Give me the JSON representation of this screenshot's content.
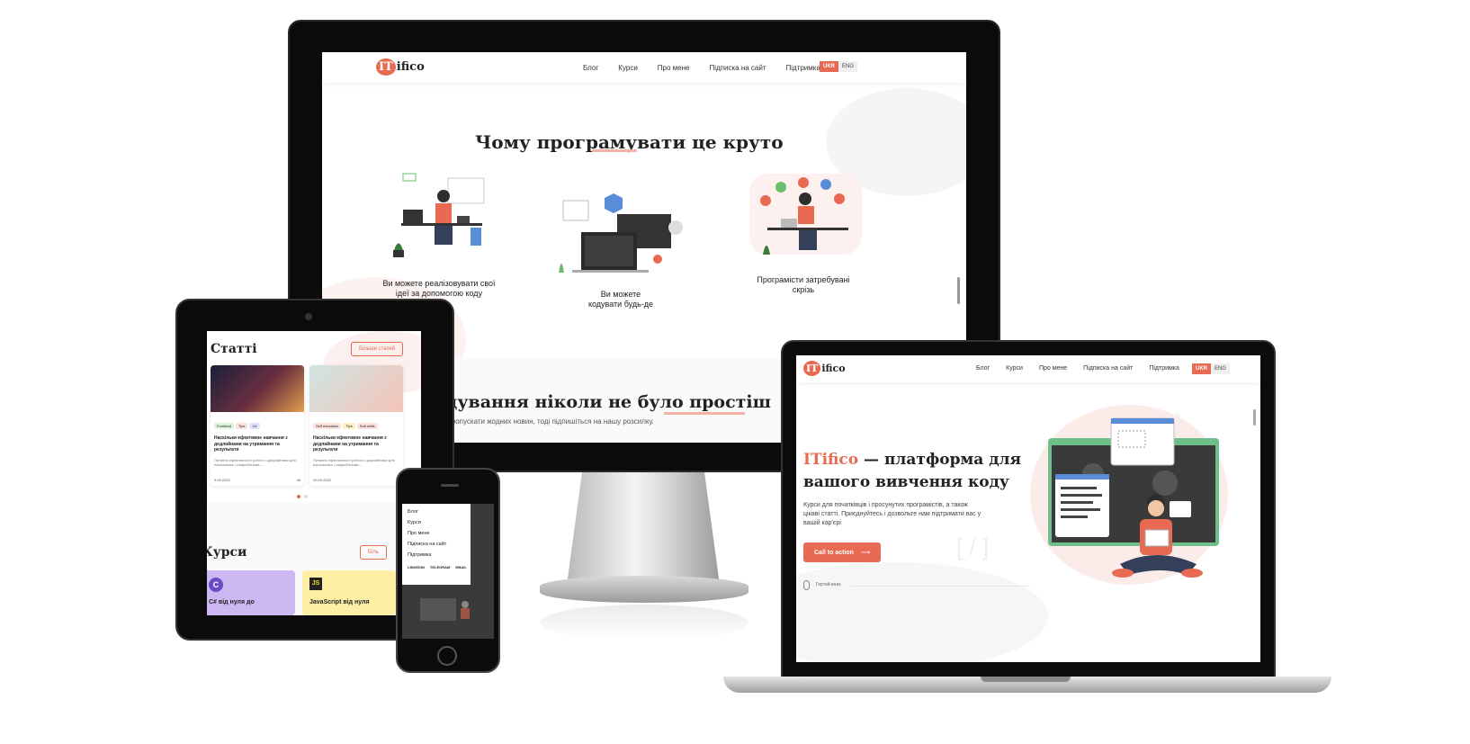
{
  "brand": {
    "logo_it": "IT",
    "logo_rest": "ifico",
    "accent": "#e86a52"
  },
  "nav": {
    "items": [
      "Блог",
      "Курси",
      "Про мене",
      "Підписка на сайт",
      "Підтримка"
    ],
    "lang_active": "UKR",
    "lang_other": "ENG"
  },
  "desktop": {
    "section_title": "Чому програмувати це круто",
    "features": [
      {
        "caption_line1": "Ви можете реалізовувати свої",
        "caption_line2": "ідеї за допомогою коду"
      },
      {
        "caption_line1": "Ви можете",
        "caption_line2": "кодувати будь-де"
      },
      {
        "caption_line1": "Програмісти затребувані",
        "caption_line2": "скрізь"
      }
    ],
    "banner_title": "одування ніколи не було простіш",
    "banner_sub": "ете пропускати жодних новин, тоді підпишіться на нашу розсилку."
  },
  "tablet": {
    "articles_title": "Статті",
    "more_articles": "Більше статей",
    "cards": [
      {
        "tags": [
          "Frontend",
          "Tips",
          "C#"
        ],
        "title": "Наскільки ефективне навчання з дедлайнами на утримання та результати",
        "excerpt": "Питання ефективності роботи з дедлайнами для начальника і співробітників…",
        "date": "9.09.2022",
        "views": "48"
      },
      {
        "tags": [
          "Self education",
          "Tips",
          "Soft skills"
        ],
        "title": "Наскільки ефективне навчання з дедлайнами на утримання та результати",
        "excerpt": "Питання ефективності роботи з дедлайнами для начальника і співробітників…",
        "date": "29.09.2022",
        "views": ""
      }
    ],
    "courses_title": "Курси",
    "course_cards": [
      {
        "icon": "C",
        "title": "C# від нуля до"
      },
      {
        "icon": "JS",
        "title": "JavaScript від нуля"
      }
    ],
    "more_courses": "Біль"
  },
  "phone": {
    "menu": [
      "Блог",
      "Курси",
      "Про мене",
      "Підписка на сайт",
      "Підтримка"
    ],
    "socials": [
      "LINKEDIN",
      "TELEGRAM",
      "EMAIL"
    ]
  },
  "laptop": {
    "hero_title_brand": "ITifico",
    "hero_title_rest_1": " — платформа для",
    "hero_title_rest_2": "вашого вивчення коду",
    "hero_text": "Курси для початківців і просунутих програмістів, а також цікаві статті. Приєднуйтесь і дозвольте нам підтримати вас у вашій кар'єрі",
    "cta": "Call to action",
    "scroll_hint": "Гортай вниз"
  }
}
